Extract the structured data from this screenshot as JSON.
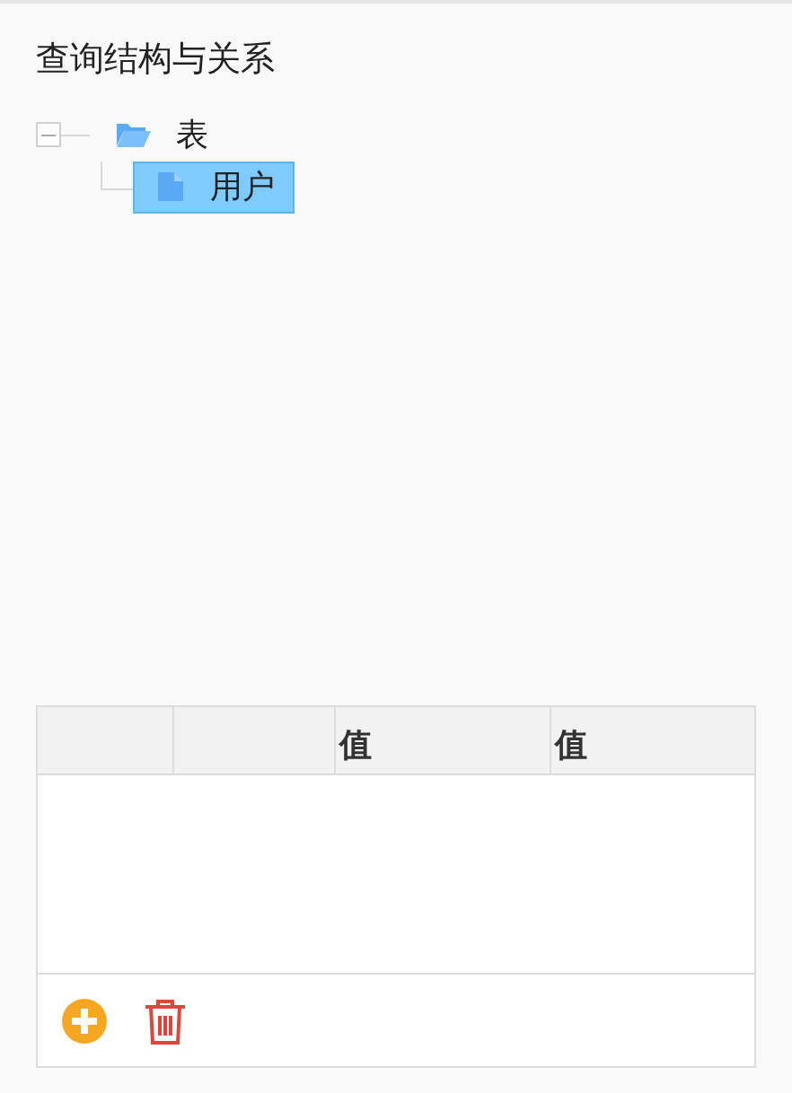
{
  "title": "查询结构与关系",
  "tree": [
    {
      "label": "表",
      "kind": "folder",
      "expanded": true,
      "selected": false,
      "children": [
        {
          "label": "用户",
          "kind": "file",
          "selected": true
        }
      ]
    }
  ],
  "table": {
    "columns": [
      "",
      "",
      "值",
      "值"
    ]
  },
  "footer": {
    "buttons": [
      {
        "kind": "add"
      },
      {
        "kind": "delete"
      }
    ]
  }
}
